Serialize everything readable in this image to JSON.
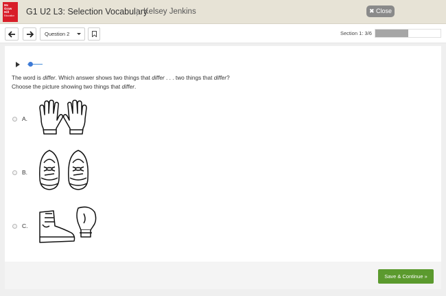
{
  "header": {
    "logo_lines": [
      "Mc",
      "Graw",
      "Hill",
      "Education"
    ],
    "title": "G1 U2 L3: Selection Vocabulary",
    "separator": "|",
    "user": "Kelsey Jenkins",
    "close_label": "Close",
    "close_icon": "x-icon"
  },
  "toolbar": {
    "back_icon": "arrow-left-icon",
    "forward_icon": "arrow-right-icon",
    "question_select": "Question 2",
    "bookmark_icon": "bookmark-icon",
    "section_text": "Section 1: 3/6",
    "progress_fraction": 0.5
  },
  "question": {
    "audio": {
      "play_icon": "play-icon",
      "position_fraction": 0.05
    },
    "prompt_parts": [
      "The word is ",
      "differ",
      ". Which answer shows two things that ",
      "differ",
      " . . . two things that ",
      "differ",
      "?"
    ],
    "prompt_line2_parts": [
      "Choose the picture showing two things that ",
      "differ",
      "."
    ],
    "options": [
      {
        "letter": "A.",
        "picture": "pair of gloves"
      },
      {
        "letter": "B.",
        "picture": "pair of sneakers"
      },
      {
        "letter": "C.",
        "picture": "boot and boxing glove"
      }
    ]
  },
  "footer": {
    "save_label": "Save & Continue »"
  },
  "colors": {
    "header_bg": "#e7e3d6",
    "logo_red": "#d81e28",
    "save_green": "#5b9a2e",
    "audio_blue": "#3d7ad6"
  }
}
